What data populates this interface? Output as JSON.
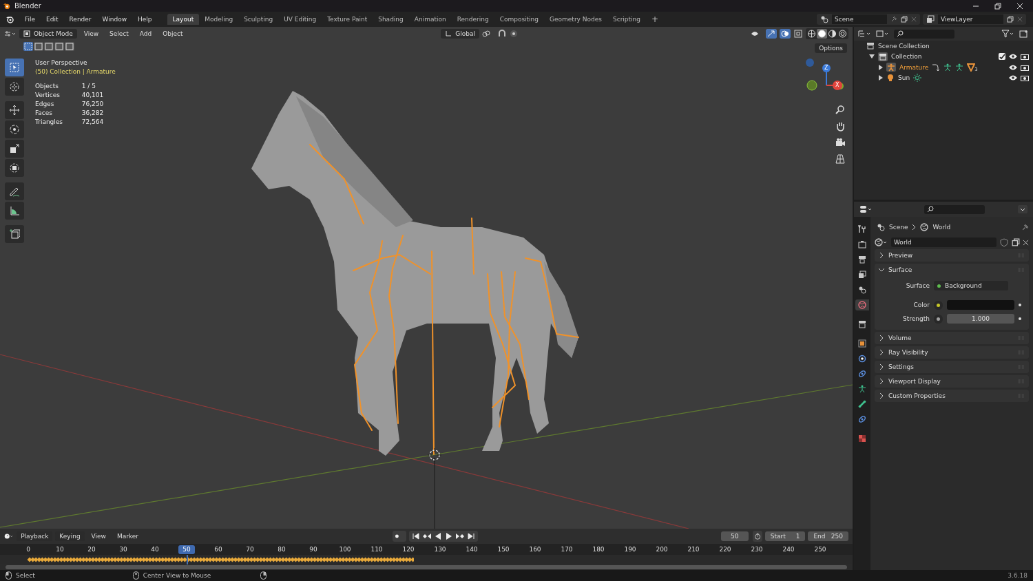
{
  "window": {
    "title": "Blender"
  },
  "menu": [
    "File",
    "Edit",
    "Render",
    "Window",
    "Help"
  ],
  "workspaces": [
    {
      "label": "Layout",
      "selected": true
    },
    {
      "label": "Modeling",
      "selected": false
    },
    {
      "label": "Sculpting",
      "selected": false
    },
    {
      "label": "UV Editing",
      "selected": false
    },
    {
      "label": "Texture Paint",
      "selected": false
    },
    {
      "label": "Shading",
      "selected": false
    },
    {
      "label": "Animation",
      "selected": false
    },
    {
      "label": "Rendering",
      "selected": false
    },
    {
      "label": "Compositing",
      "selected": false
    },
    {
      "label": "Geometry Nodes",
      "selected": false
    },
    {
      "label": "Scripting",
      "selected": false
    }
  ],
  "add_workspace": "+",
  "scene": "Scene",
  "view_layer": "ViewLayer",
  "viewport": {
    "mode": "Object Mode",
    "menus": [
      "View",
      "Select",
      "Add",
      "Object"
    ],
    "orientation": "Global",
    "options": "Options",
    "view_name": "User Perspective",
    "context": "(50) Collection | Armature",
    "stats": [
      {
        "label": "Objects",
        "value": "1 / 5"
      },
      {
        "label": "Vertices",
        "value": "40,101"
      },
      {
        "label": "Edges",
        "value": "76,250"
      },
      {
        "label": "Faces",
        "value": "36,282"
      },
      {
        "label": "Triangles",
        "value": "72,564"
      }
    ],
    "tools": [
      {
        "kind": "select",
        "selected": true
      },
      {
        "kind": "cursor",
        "selected": false
      },
      {
        "kind": "move",
        "selected": false
      },
      {
        "kind": "rotate",
        "selected": false
      },
      {
        "kind": "scale",
        "selected": false
      },
      {
        "kind": "transform",
        "selected": false
      },
      {
        "kind": "annotate",
        "selected": false
      },
      {
        "kind": "measure",
        "selected": false
      },
      {
        "kind": "add-cube",
        "selected": false
      }
    ],
    "shading": [
      {
        "kind": "wireframe",
        "selected": false
      },
      {
        "kind": "solid",
        "selected": true
      },
      {
        "kind": "material",
        "selected": false
      },
      {
        "kind": "rendered",
        "selected": false
      }
    ],
    "axes": [
      "Z",
      "X"
    ]
  },
  "outliner": {
    "root": "Scene Collection",
    "collection": {
      "label": "Collection",
      "expanded": true,
      "checked": true
    },
    "objects": [
      {
        "label": "Armature",
        "kind": "armature",
        "active": true,
        "modifier_count": "3"
      },
      {
        "label": "Sun",
        "kind": "light",
        "active": false
      }
    ]
  },
  "properties": {
    "breadcrumb": [
      "Scene",
      "World"
    ],
    "datablock": "World",
    "tabs": [
      {
        "kind": "tool",
        "selected": false
      },
      {
        "kind": "render",
        "selected": false
      },
      {
        "kind": "output",
        "selected": false
      },
      {
        "kind": "view-layer",
        "selected": false
      },
      {
        "kind": "scene",
        "selected": false
      },
      {
        "kind": "world",
        "selected": true
      },
      {
        "kind": "collection",
        "selected": false
      },
      {
        "kind": "object",
        "selected": false
      },
      {
        "kind": "physics",
        "selected": false
      },
      {
        "kind": "constraints",
        "selected": false
      },
      {
        "kind": "data",
        "selected": false
      },
      {
        "kind": "bone",
        "selected": false
      },
      {
        "kind": "bone-constraints",
        "selected": false
      },
      {
        "kind": "texture",
        "selected": false
      }
    ],
    "panels": [
      {
        "label": "Preview",
        "expanded": false
      },
      {
        "label": "Surface",
        "expanded": true,
        "fields": [
          {
            "kind": "shader",
            "label": "Surface",
            "value": "Background",
            "color": "#5ebd4e"
          },
          {
            "kind": "color",
            "label": "Color",
            "color": "#c7c729"
          },
          {
            "kind": "number",
            "label": "Strength",
            "value": "1.000",
            "color": "#a1a1a1"
          }
        ]
      },
      {
        "label": "Volume",
        "expanded": false
      },
      {
        "label": "Ray Visibility",
        "expanded": false
      },
      {
        "label": "Settings",
        "expanded": false
      },
      {
        "label": "Viewport Display",
        "expanded": false
      },
      {
        "label": "Custom Properties",
        "expanded": false
      }
    ]
  },
  "timeline": {
    "menus": [
      "Playback",
      "Keying",
      "View",
      "Marker"
    ],
    "current_frame": "50",
    "start_label": "Start",
    "start": "1",
    "end_label": "End",
    "end": "250",
    "ticks": [
      {
        "label": "0",
        "selected": false
      },
      {
        "label": "10",
        "selected": false
      },
      {
        "label": "20",
        "selected": false
      },
      {
        "label": "30",
        "selected": false
      },
      {
        "label": "40",
        "selected": false
      },
      {
        "label": "50",
        "selected": true
      },
      {
        "label": "60",
        "selected": false
      },
      {
        "label": "70",
        "selected": false
      },
      {
        "label": "80",
        "selected": false
      },
      {
        "label": "90",
        "selected": false
      },
      {
        "label": "100",
        "selected": false
      },
      {
        "label": "110",
        "selected": false
      },
      {
        "label": "120",
        "selected": false
      },
      {
        "label": "130",
        "selected": false
      },
      {
        "label": "140",
        "selected": false
      },
      {
        "label": "150",
        "selected": false
      },
      {
        "label": "160",
        "selected": false
      },
      {
        "label": "170",
        "selected": false
      },
      {
        "label": "180",
        "selected": false
      },
      {
        "label": "190",
        "selected": false
      },
      {
        "label": "200",
        "selected": false
      },
      {
        "label": "210",
        "selected": false
      },
      {
        "label": "220",
        "selected": false
      },
      {
        "label": "230",
        "selected": false
      },
      {
        "label": "240",
        "selected": false
      },
      {
        "label": "250",
        "selected": false
      }
    ]
  },
  "status_bar": {
    "hints": [
      "Select",
      "Center View to Mouse"
    ],
    "version": "3.6.18"
  }
}
